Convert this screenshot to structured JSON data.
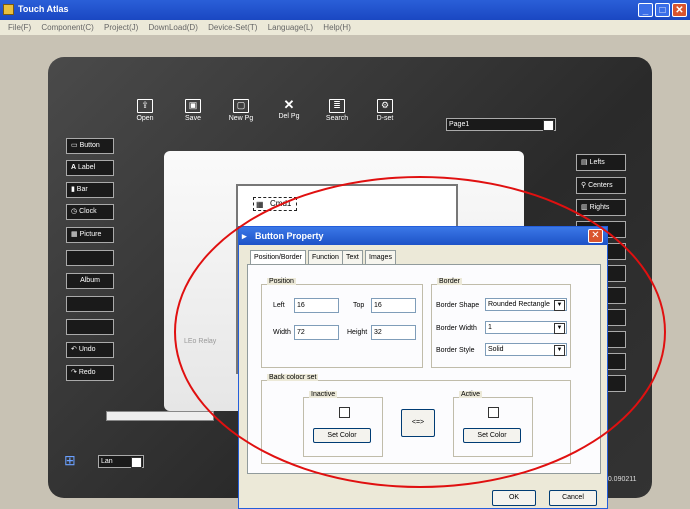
{
  "window": {
    "title": "Touch Atlas"
  },
  "menu": [
    "File(F)",
    "Component(C)",
    "Project(J)",
    "DownLoad(D)",
    "Device-Set(T)",
    "Language(L)",
    "Help(H)"
  ],
  "toolbar": [
    {
      "label": "Open",
      "icon": "open-icon"
    },
    {
      "label": "Save",
      "icon": "save-icon"
    },
    {
      "label": "New Pg",
      "icon": "new-page-icon"
    },
    {
      "label": "Del Pg",
      "icon": "delete-page-icon"
    },
    {
      "label": "Search",
      "icon": "search-icon"
    },
    {
      "label": "D-set",
      "icon": "device-set-icon"
    }
  ],
  "page_select": "Page1",
  "left_buttons": [
    "Button",
    "Label",
    "Bar",
    "Clock",
    "Picture",
    "",
    "Album",
    "",
    "",
    "Undo",
    "Redo"
  ],
  "right_buttons": [
    "Lefts",
    "Centers",
    "Rights"
  ],
  "canvas": {
    "cmd_label": "Cmd1",
    "device_brand": "LEo Relay"
  },
  "lang_select": "Lan",
  "version": "1.0.090211",
  "dialog": {
    "title": "Button Property",
    "tabs": [
      "Position/Border",
      "Function",
      "Text",
      "Images"
    ],
    "position": {
      "group": "Position",
      "left_label": "Left",
      "left_value": "16",
      "top_label": "Top",
      "top_value": "16",
      "width_label": "Width",
      "width_value": "72",
      "height_label": "Height",
      "height_value": "32"
    },
    "border": {
      "group": "Border",
      "shape_label": "Border Shape",
      "shape_value": "Rounded Rectangle",
      "width_label": "Border Width",
      "width_value": "1",
      "style_label": "Border Style",
      "style_value": "Solid"
    },
    "back_color": {
      "group": "Back colocr set",
      "inactive": "Inactive",
      "active": "Active",
      "set_color": "Set Color",
      "swap": "<=>"
    },
    "ok": "OK",
    "cancel": "Cancel"
  },
  "annotation_color": "#e01010"
}
